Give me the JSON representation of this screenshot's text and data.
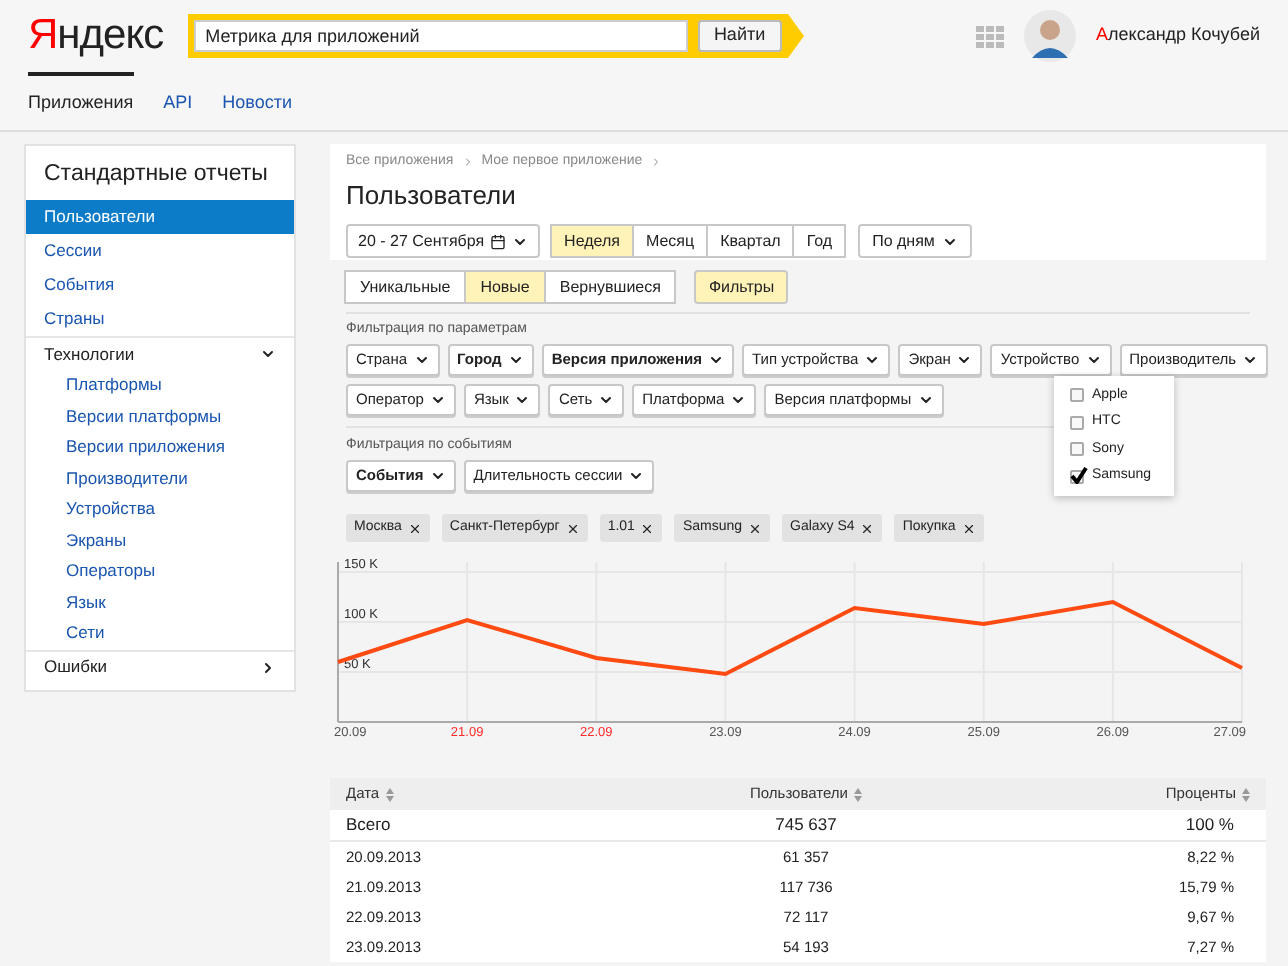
{
  "header": {
    "logo": {
      "first": "Я",
      "rest": "ндекс"
    },
    "search": {
      "value": "Метрика для приложений",
      "button": "Найти"
    },
    "user": {
      "first": "А",
      "rest": "лександр Кочубей"
    }
  },
  "nav": [
    {
      "label": "Приложения",
      "selected": true
    },
    {
      "label": "API",
      "selected": false
    },
    {
      "label": "Новости",
      "selected": false
    }
  ],
  "sidebar": {
    "title": "Стандартные отчеты",
    "items": [
      {
        "label": "Пользователи",
        "selected": true
      },
      {
        "label": "Сессии",
        "selected": false
      },
      {
        "label": "События",
        "selected": false
      },
      {
        "label": "Страны",
        "selected": false
      },
      {
        "label": "Технологии",
        "selected": false,
        "expanded": true,
        "children": [
          {
            "label": "Платформы"
          },
          {
            "label": "Версии платформы"
          },
          {
            "label": "Версии приложения"
          },
          {
            "label": "Производители"
          },
          {
            "label": "Устройства"
          },
          {
            "label": "Экраны"
          },
          {
            "label": "Операторы"
          },
          {
            "label": "Язык"
          },
          {
            "label": "Сети"
          }
        ]
      },
      {
        "label": "Ошибки",
        "selected": false,
        "expanded": false
      }
    ]
  },
  "breadcrumbs": [
    "Все приложения",
    "Мое первое приложение"
  ],
  "title": "Пользователи",
  "date_range": "20 - 27 Сентября",
  "periods": [
    {
      "label": "Неделя",
      "selected": true
    },
    {
      "label": "Месяц",
      "selected": false
    },
    {
      "label": "Квартал",
      "selected": false
    },
    {
      "label": "Год",
      "selected": false
    }
  ],
  "grouping": "По дням",
  "user_types": [
    {
      "label": "Уникальные",
      "selected": false
    },
    {
      "label": "Новые",
      "selected": true
    },
    {
      "label": "Вернувшиеся",
      "selected": false
    }
  ],
  "filters_button": {
    "label": "Фильтры",
    "selected": true
  },
  "param_filters_label": "Фильтрация по параметрам",
  "param_filters": [
    {
      "label": "Страна",
      "active": false
    },
    {
      "label": "Город",
      "active": true
    },
    {
      "label": "Версия приложения",
      "active": true
    },
    {
      "label": "Тип устройства",
      "active": false
    },
    {
      "label": "Экран",
      "active": false
    },
    {
      "label": "Устройство",
      "active": false
    },
    {
      "label": "Производитель",
      "active": false
    },
    {
      "label": "Оператор",
      "active": false
    },
    {
      "label": "Язык",
      "active": false
    },
    {
      "label": "Сеть",
      "active": false
    },
    {
      "label": "Платформа",
      "active": false
    },
    {
      "label": "Версия платформы",
      "active": false
    }
  ],
  "manufacturer_menu": [
    {
      "label": "Apple",
      "checked": false
    },
    {
      "label": "HTC",
      "checked": false
    },
    {
      "label": "Sony",
      "checked": false
    },
    {
      "label": "Samsung",
      "checked": true
    }
  ],
  "event_filters_label": "Фильтрация по событиям",
  "event_filters": [
    {
      "label": "События",
      "active": true
    },
    {
      "label": "Длительность сессии",
      "active": false
    }
  ],
  "tags": [
    "Москва",
    "Санкт-Петербург",
    "1.01",
    "Samsung",
    "Galaxy S4",
    "Покупка"
  ],
  "chart": {
    "weekend": [
      false,
      true,
      true,
      false,
      false,
      false,
      false,
      false
    ],
    "chart_data": {
      "type": "line",
      "categories": [
        "20.09",
        "21.09",
        "22.09",
        "23.09",
        "24.09",
        "25.09",
        "26.09",
        "27.09"
      ],
      "grid": true,
      "series": [
        {
          "color": "#ff4a12",
          "values": [
            60000,
            102000,
            64000,
            48000,
            114000,
            98000,
            120000,
            54000
          ]
        }
      ],
      "ylim": [
        0,
        160000
      ],
      "yticks": [
        {
          "value": 50000,
          "label": "50 K"
        },
        {
          "value": 100000,
          "label": "100 K"
        },
        {
          "value": 150000,
          "label": "150 K"
        }
      ]
    }
  },
  "table": {
    "columns": [
      "Дата",
      "Пользователи",
      "Проценты"
    ],
    "total": {
      "label": "Всего",
      "users": "745 637",
      "percent": "100 %"
    },
    "rows": [
      {
        "date": "20.09.2013",
        "users": "61 357",
        "percent": "8,22 %"
      },
      {
        "date": "21.09.2013",
        "users": "117 736",
        "percent": "15,79 %"
      },
      {
        "date": "22.09.2013",
        "users": "72 117",
        "percent": "9,67 %"
      },
      {
        "date": "23.09.2013",
        "users": "54 193",
        "percent": "7,27 %"
      }
    ]
  }
}
